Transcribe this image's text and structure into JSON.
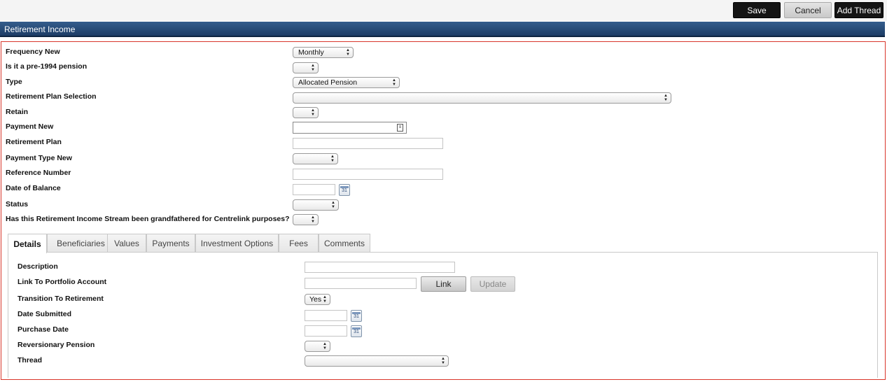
{
  "toolbar": {
    "save": "Save",
    "cancel": "Cancel",
    "add_thread": "Add Thread"
  },
  "section": {
    "title": "Retirement Income"
  },
  "fields": {
    "frequency_new": {
      "label": "Frequency New",
      "value": "Monthly"
    },
    "pre_1994": {
      "label": "Is it a pre-1994 pension",
      "value": ""
    },
    "type": {
      "label": "Type",
      "value": "Allocated Pension"
    },
    "plan_selection": {
      "label": "Retirement Plan Selection",
      "value": ""
    },
    "retain": {
      "label": "Retain",
      "value": ""
    },
    "payment_new": {
      "label": "Payment New",
      "value": ""
    },
    "retirement_plan": {
      "label": "Retirement Plan",
      "value": ""
    },
    "payment_type_new": {
      "label": "Payment Type New",
      "value": ""
    },
    "reference_number": {
      "label": "Reference Number",
      "value": ""
    },
    "date_of_balance": {
      "label": "Date of Balance",
      "value": ""
    },
    "status": {
      "label": "Status",
      "value": ""
    },
    "grandfathered": {
      "label": "Has this Retirement Income Stream been grandfathered for Centrelink purposes?",
      "value": ""
    }
  },
  "tabs": [
    "Details",
    "Beneficiaries",
    "Values",
    "Payments",
    "Investment Options",
    "Fees",
    "Comments"
  ],
  "details": {
    "description": {
      "label": "Description",
      "value": ""
    },
    "link_portfolio": {
      "label": "Link To Portfolio Account",
      "value": "",
      "link_button": "Link",
      "update_button": "Update"
    },
    "transition": {
      "label": "Transition To Retirement",
      "value": "Yes"
    },
    "date_submitted": {
      "label": "Date Submitted",
      "value": ""
    },
    "purchase_date": {
      "label": "Purchase Date",
      "value": ""
    },
    "reversionary": {
      "label": "Reversionary Pension",
      "value": ""
    },
    "thread": {
      "label": "Thread",
      "value": ""
    }
  },
  "calendar_icon_text": "31"
}
